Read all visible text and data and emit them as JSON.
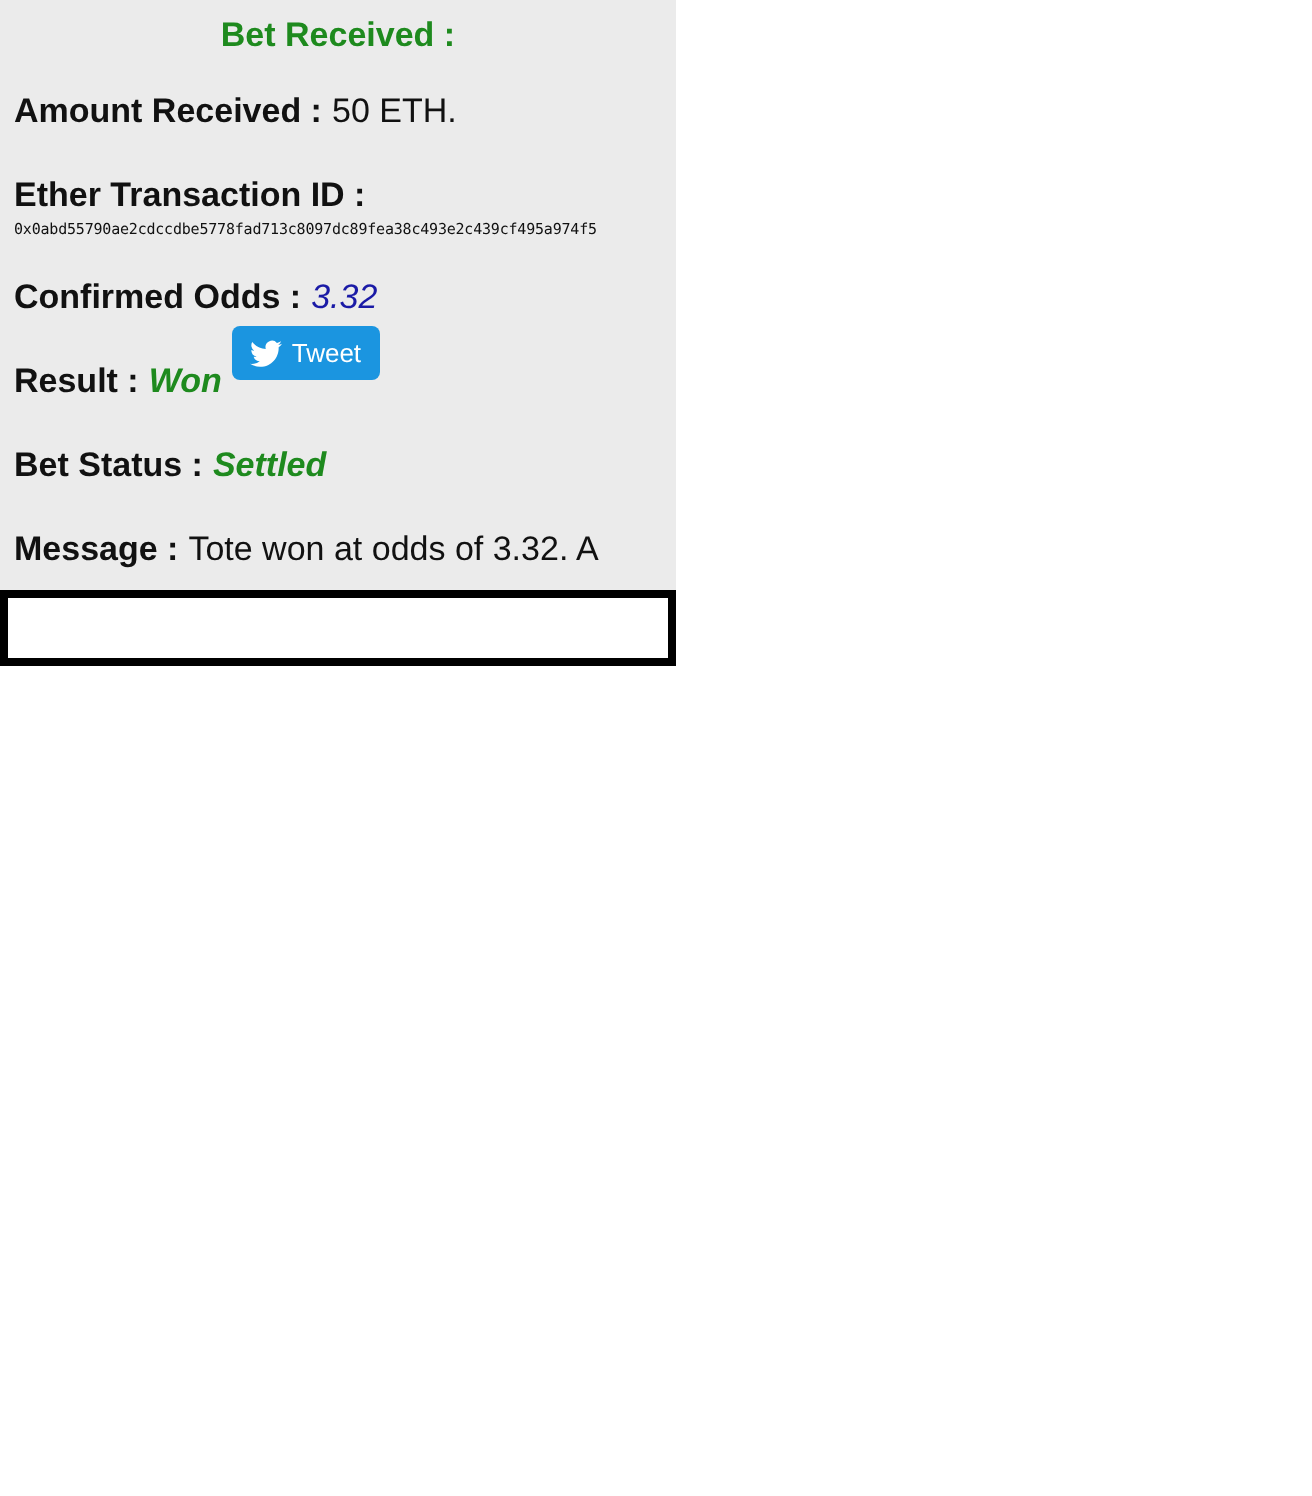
{
  "title": "Bet Received :",
  "rows": [
    {
      "label": "Amount Received :",
      "value": "50 ETH.",
      "kind": "plain"
    },
    {
      "label": "Ether Transaction ID :",
      "value": "0x0abd55790ae2cdccdbe5778fad713c8097dc89fea38c493e2c439cf495a974f5",
      "kind": "hash"
    },
    {
      "label": "Confirmed Odds :",
      "value": "3.32",
      "kind": "odds"
    },
    {
      "label": "Result :",
      "value": "Won",
      "kind": "outcome",
      "button": "Tweet"
    },
    {
      "label": "Bet Status :",
      "value": "Settled",
      "kind": "outcome"
    },
    {
      "label": "Message :",
      "value": "Tote won at odds of 3.32. A",
      "kind": "plain"
    }
  ]
}
